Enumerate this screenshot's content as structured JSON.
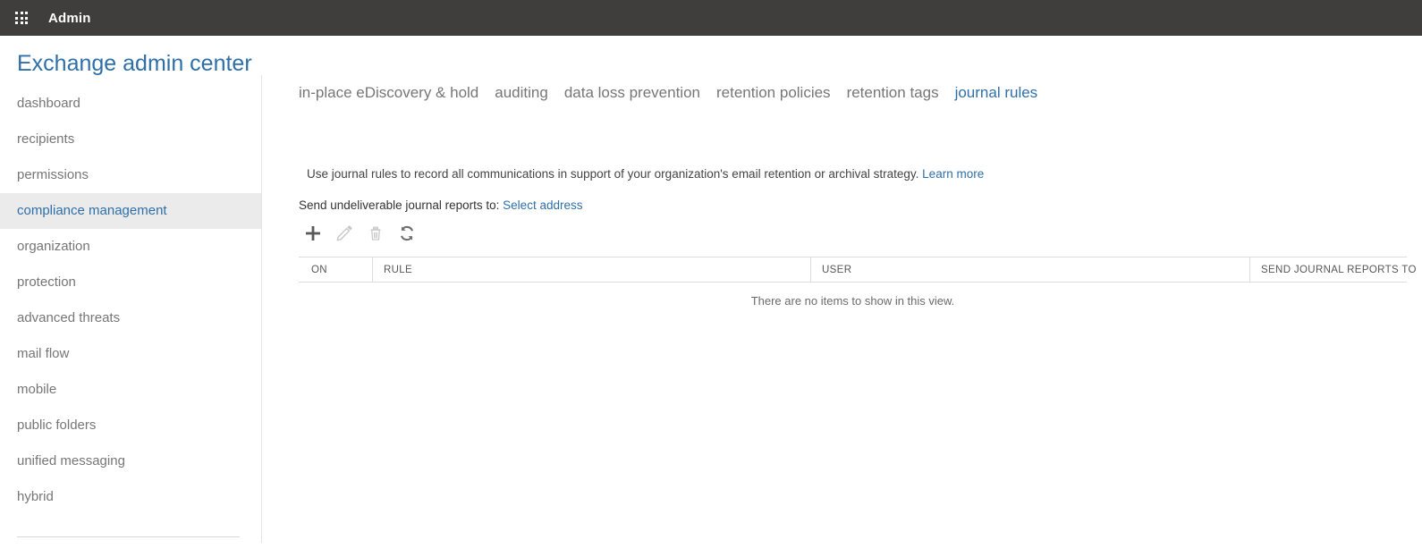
{
  "suite": {
    "waffle_icon": "app-launcher-waffle-icon",
    "title": "Admin"
  },
  "page": {
    "title": "Exchange admin center"
  },
  "sidebar": {
    "items": [
      {
        "label": "dashboard",
        "selected": false
      },
      {
        "label": "recipients",
        "selected": false
      },
      {
        "label": "permissions",
        "selected": false
      },
      {
        "label": "compliance management",
        "selected": true
      },
      {
        "label": "organization",
        "selected": false
      },
      {
        "label": "protection",
        "selected": false
      },
      {
        "label": "advanced threats",
        "selected": false
      },
      {
        "label": "mail flow",
        "selected": false
      },
      {
        "label": "mobile",
        "selected": false
      },
      {
        "label": "public folders",
        "selected": false
      },
      {
        "label": "unified messaging",
        "selected": false
      },
      {
        "label": "hybrid",
        "selected": false
      }
    ]
  },
  "tabs": [
    {
      "label": "in-place eDiscovery & hold",
      "active": false
    },
    {
      "label": "auditing",
      "active": false
    },
    {
      "label": "data loss prevention",
      "active": false
    },
    {
      "label": "retention policies",
      "active": false
    },
    {
      "label": "retention tags",
      "active": false
    },
    {
      "label": "journal rules",
      "active": true
    }
  ],
  "main": {
    "description": "Use journal rules to record all communications in support of your organization's email retention or archival strategy.",
    "learn_more_label": "Learn more",
    "undeliverable_label": "Send undeliverable journal reports to:",
    "select_address_label": "Select address",
    "toolbar": [
      {
        "name": "add-icon",
        "enabled": true
      },
      {
        "name": "edit-pencil-icon",
        "enabled": false
      },
      {
        "name": "delete-trash-icon",
        "enabled": false
      },
      {
        "name": "refresh-icon",
        "enabled": true
      }
    ],
    "table": {
      "columns": [
        "ON",
        "RULE",
        "USER",
        "SEND JOURNAL REPORTS TO"
      ],
      "rows": [],
      "empty_message": "There are no items to show in this view."
    }
  },
  "colors": {
    "suite_bar": "#403e3d",
    "accent_blue": "#2f6fa8",
    "selected_nav_bg": "#ebebeb",
    "muted_text": "#767676",
    "border": "#dcdcdc"
  }
}
